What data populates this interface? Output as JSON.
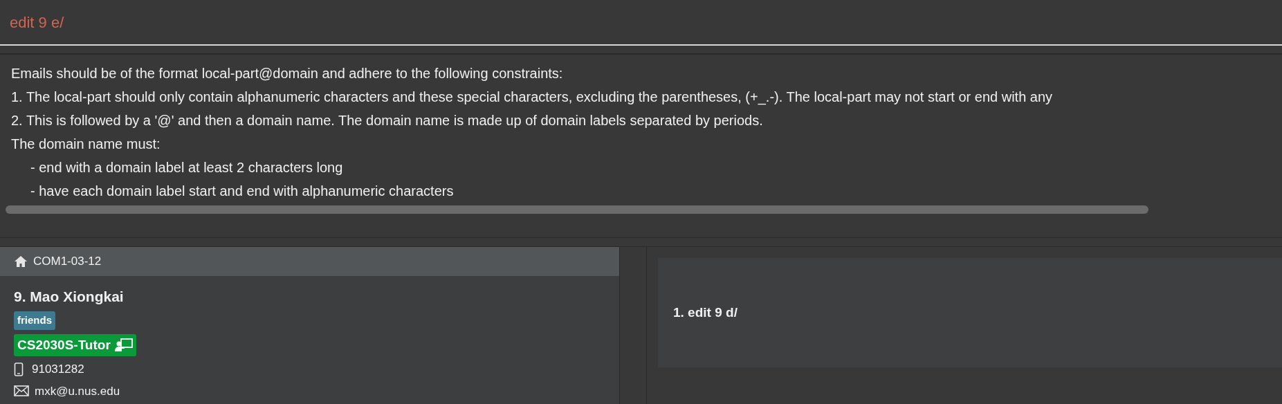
{
  "command_box": {
    "value": "edit 9 e/",
    "error": true
  },
  "result_display": {
    "lines": [
      {
        "text": "Emails should be of the format local-part@domain and adhere to the following constraints:",
        "indented": false
      },
      {
        "text": "1. The local-part should only contain alphanumeric characters and these special characters, excluding the parentheses, (+_.-). The local-part may not start or end with any",
        "indented": false
      },
      {
        "text": "2. This is followed by a '@' and then a domain name. The domain name is made up of domain labels separated by periods.",
        "indented": false
      },
      {
        "text": "The domain name must:",
        "indented": false
      },
      {
        "text": "- end with a domain label at least 2 characters long",
        "indented": true
      },
      {
        "text": "- have each domain label start and end with alphanumeric characters",
        "indented": true
      }
    ]
  },
  "person_list": [
    {
      "selected": true,
      "address": "COM1-03-12"
    },
    {
      "selected": false,
      "name": "9. Mao Xiongkai",
      "tags": [
        "friends"
      ],
      "roles": [
        "CS2030S-Tutor"
      ],
      "phone": "91031282",
      "email": "mxk@u.nus.edu"
    }
  ],
  "history": [
    {
      "text": "1. edit 9 d/"
    }
  ]
}
